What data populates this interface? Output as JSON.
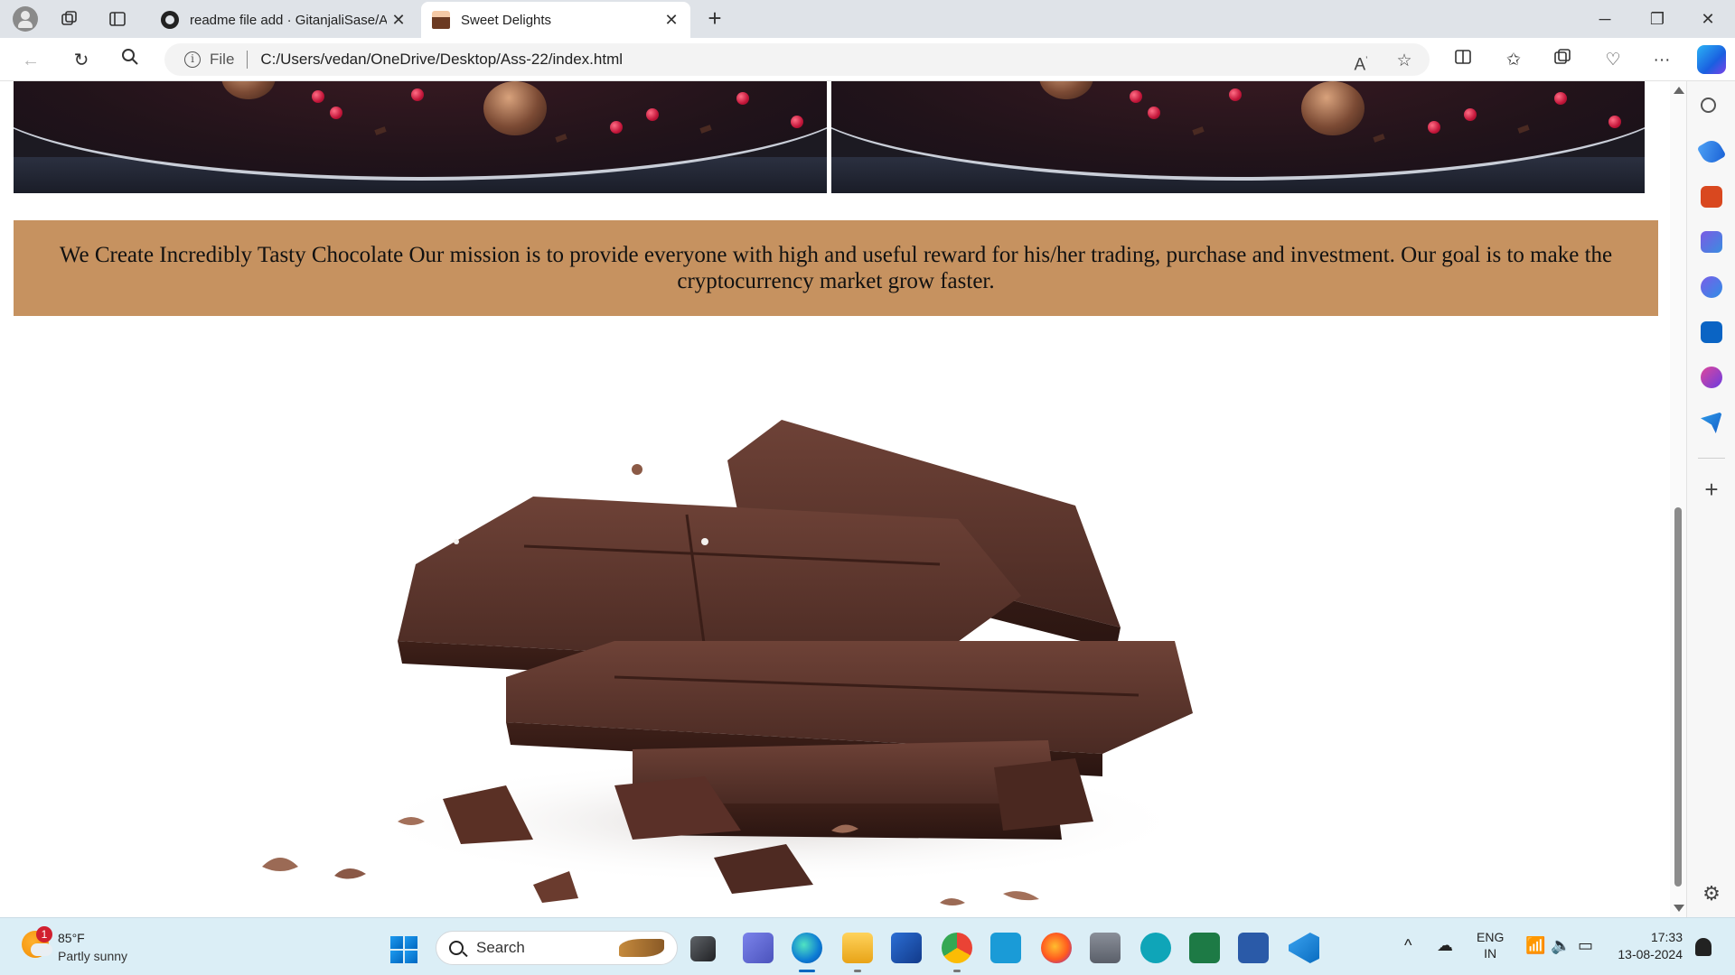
{
  "browser": {
    "tabs": [
      {
        "title": "readme file add · GitanjaliSase/A",
        "active": false,
        "icon": "github-icon"
      },
      {
        "title": "Sweet Delights",
        "active": true,
        "icon": "cake-icon"
      }
    ],
    "address": {
      "file_label": "File",
      "url": "C:/Users/vedan/OneDrive/Desktop/Ass-22/index.html"
    }
  },
  "page": {
    "mission_text": "We Create Incredibly Tasty Chocolate Our mission is to provide everyone with high and useful reward for his/her trading, purchase and investment. Our goal is to make the cryptocurrency market grow faster.",
    "images": [
      "chocolate-platter-image",
      "chocolate-platter-image",
      "chocolate-bars-image"
    ]
  },
  "taskbar": {
    "weather": {
      "temp": "85°F",
      "condition": "Partly sunny",
      "badge": "1"
    },
    "search_placeholder": "Search",
    "language": {
      "line1": "ENG",
      "line2": "IN"
    },
    "clock": {
      "time": "17:33",
      "date": "13-08-2024"
    }
  },
  "colors": {
    "mission_bg": "#c69260",
    "accent": "#0067c0"
  }
}
